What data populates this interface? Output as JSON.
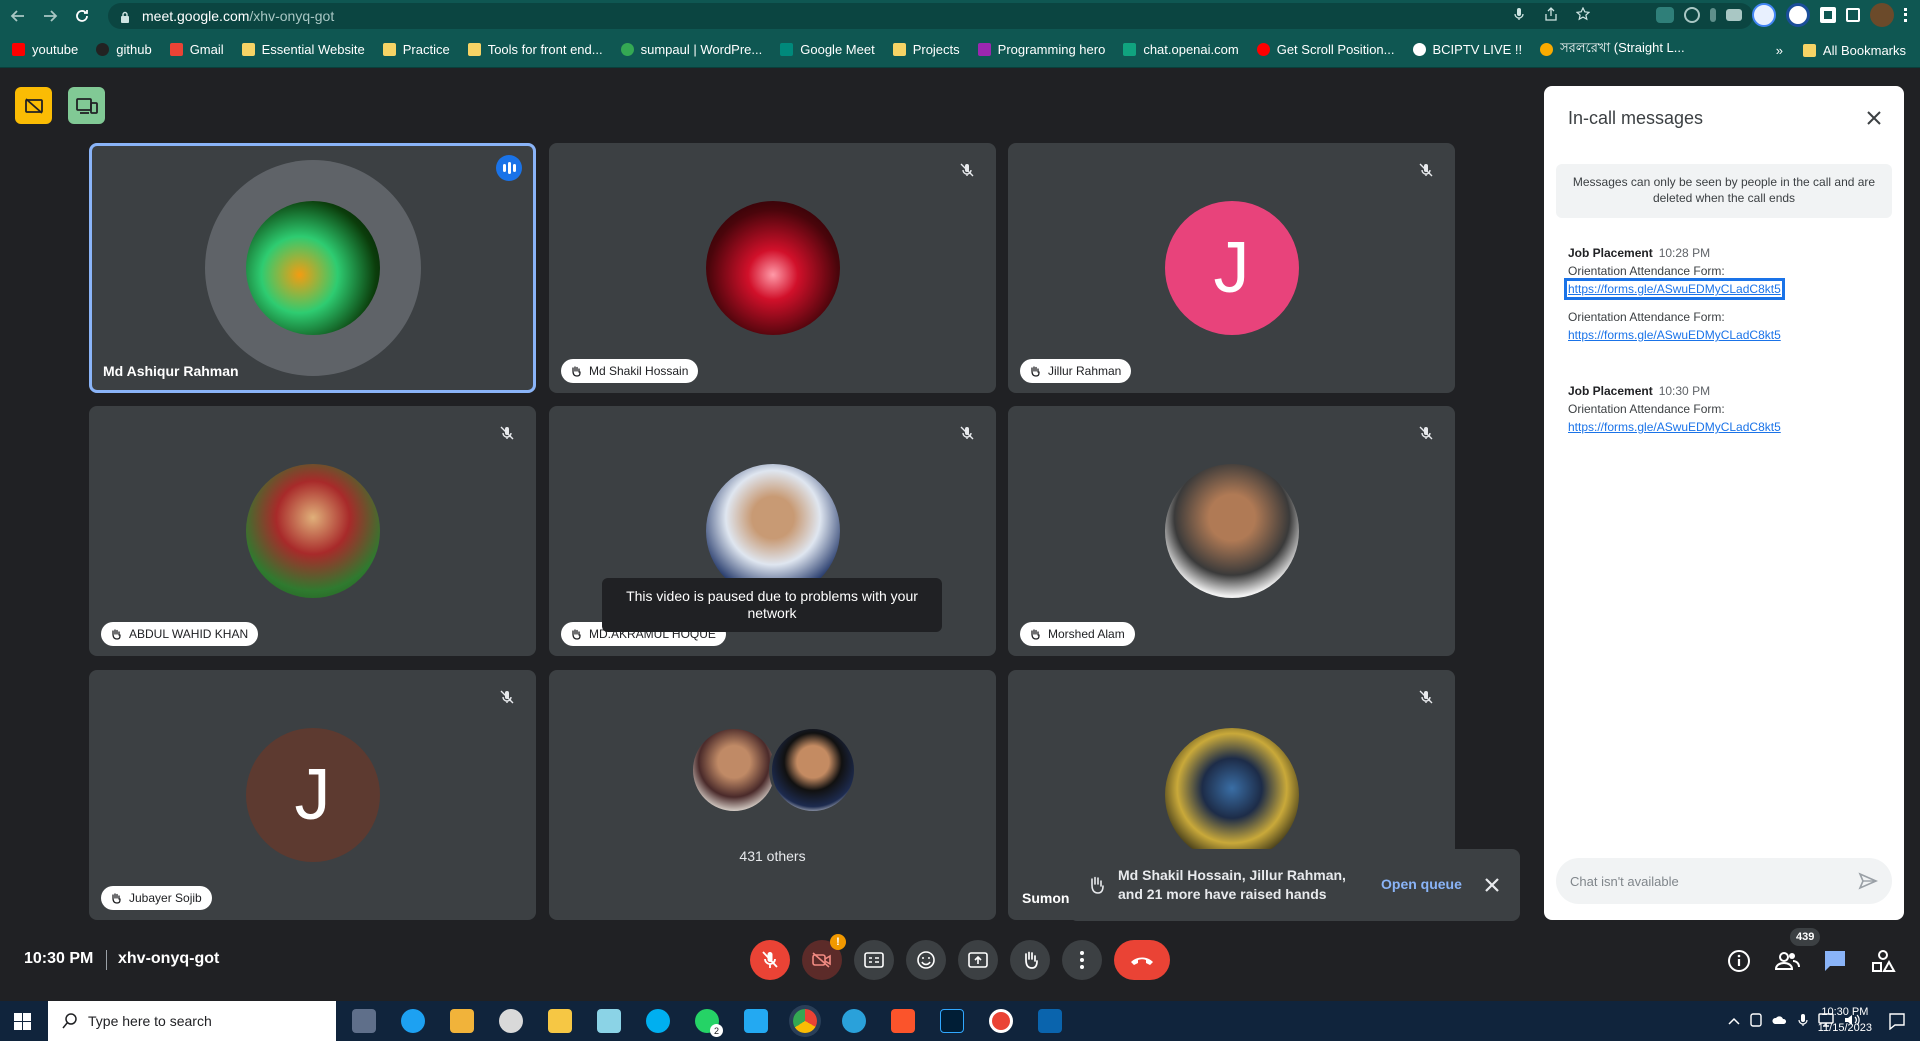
{
  "browser": {
    "url_host": "meet.google.com",
    "url_path": "/xhv-onyq-got",
    "bookmarks": [
      {
        "label": "youtube",
        "color": "#ff0000"
      },
      {
        "label": "github",
        "color": "#222222"
      },
      {
        "label": "Gmail",
        "color": "#ea4335"
      },
      {
        "label": "Essential Website",
        "color": "#f6d365"
      },
      {
        "label": "Practice",
        "color": "#f6d365"
      },
      {
        "label": "Tools for front end...",
        "color": "#f6d365"
      },
      {
        "label": "sumpaul | WordPre...",
        "color": "#34a853"
      },
      {
        "label": "Google Meet",
        "color": "#00897b"
      },
      {
        "label": "Projects",
        "color": "#f6d365"
      },
      {
        "label": "Programming hero",
        "color": "#9c27b0"
      },
      {
        "label": "chat.openai.com",
        "color": "#10a37f"
      },
      {
        "label": "Get Scroll Position...",
        "color": "#ff0000"
      },
      {
        "label": "BCIPTV LIVE !!",
        "color": "#ffffff"
      },
      {
        "label": "সরলরেখা (Straight L...",
        "color": "#f9ab00"
      }
    ],
    "all_bookmarks": "All Bookmarks",
    "overflow": "»"
  },
  "tiles": [
    {
      "name": "Md Ashiqur Rahman",
      "style": "plain",
      "active": true,
      "avatar_kind": "photo",
      "avatar_color": "#1b3a1b"
    },
    {
      "name": "Md Shakil Hossain",
      "style": "chip",
      "active": false,
      "avatar_kind": "photo",
      "avatar_color": "#5a0c10"
    },
    {
      "name": "Jillur Rahman",
      "style": "chip",
      "active": false,
      "avatar_kind": "letter",
      "letter": "J",
      "avatar_color": "#e8437b"
    },
    {
      "name": "ABDUL WAHID KHAN",
      "style": "chip",
      "active": false,
      "avatar_kind": "photo",
      "avatar_color": "#2f7a2f"
    },
    {
      "name": "MD.AKRAMUL HOQUE",
      "style": "chip",
      "active": false,
      "avatar_kind": "photo",
      "avatar_color": "#23345a"
    },
    {
      "name": "Morshed Alam",
      "style": "chip",
      "active": false,
      "avatar_kind": "photo",
      "avatar_color": "#f0f0f0"
    },
    {
      "name": "Jubayer Sojib",
      "style": "chip",
      "active": false,
      "avatar_kind": "letter",
      "letter": "J",
      "avatar_color": "#5d3a30"
    },
    {
      "name": "",
      "style": "others",
      "others_label": "431 others"
    },
    {
      "name": "Sumon",
      "style": "plain",
      "active": false,
      "avatar_kind": "photo",
      "avatar_color": "#2a2a1a"
    }
  ],
  "paused_notice": "This video is paused due to problems with your network",
  "hands_toast": {
    "text": "Md Shakil Hossain, Jillur Rahman, and 21 more have raised hands",
    "action": "Open queue"
  },
  "chat": {
    "title": "In-call messages",
    "notice": "Messages can only be seen by people in the call and are deleted when the call ends",
    "groups": [
      {
        "sender": "Job Placement",
        "time": "10:28 PM",
        "messages": [
          {
            "text": "Orientation Attendance Form:",
            "link": "https://forms.gle/ASwuEDMyCLadC8kt5",
            "focused": true
          },
          {
            "text": "Orientation Attendance Form:",
            "link": "https://forms.gle/ASwuEDMyCLadC8kt5",
            "focused": false
          }
        ]
      },
      {
        "sender": "Job Placement",
        "time": "10:30 PM",
        "messages": [
          {
            "text": "Orientation Attendance Form:",
            "link": "https://forms.gle/ASwuEDMyCLadC8kt5",
            "focused": false
          }
        ]
      }
    ],
    "input_placeholder": "Chat isn't available"
  },
  "bottom": {
    "time": "10:30 PM",
    "meeting_code": "xhv-onyq-got",
    "participant_count": "439",
    "camera_alert": "!"
  },
  "taskbar": {
    "search_placeholder": "Type here to search",
    "time": "10:30 PM",
    "date": "11/15/2023",
    "whatsapp_badge": "2"
  }
}
